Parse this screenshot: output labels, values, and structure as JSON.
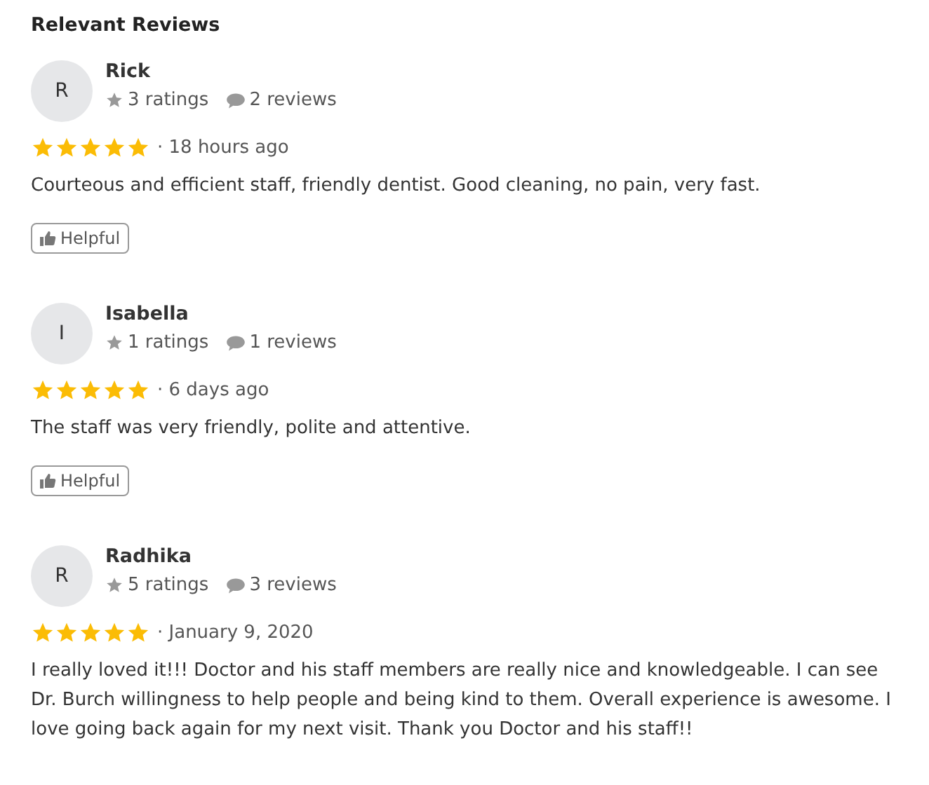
{
  "heading": "Relevant Reviews",
  "reviews": [
    {
      "avatar": "R",
      "name": "Rick",
      "ratings": "3 ratings",
      "review_count": "2 reviews",
      "stars": 5,
      "time": "· 18 hours ago",
      "text": "Courteous and efficient staff, friendly dentist. Good cleaning, no pain, very fast.",
      "helpful": "Helpful"
    },
    {
      "avatar": "I",
      "name": "Isabella",
      "ratings": "1 ratings",
      "review_count": "1 reviews",
      "stars": 5,
      "time": "· 6 days ago",
      "text": "The staff was very friendly, polite and attentive.",
      "helpful": "Helpful"
    },
    {
      "avatar": "R",
      "name": "Radhika",
      "ratings": "5 ratings",
      "review_count": "3 reviews",
      "stars": 5,
      "time": "· January 9, 2020",
      "text": "I really loved it!!! Doctor and his staff members are really nice and knowledgeable. I can see Dr. Burch willingness to help people and being kind to them. Overall experience is awesome. I love going back again for my next visit. Thank you Doctor and his staff!!"
    }
  ]
}
